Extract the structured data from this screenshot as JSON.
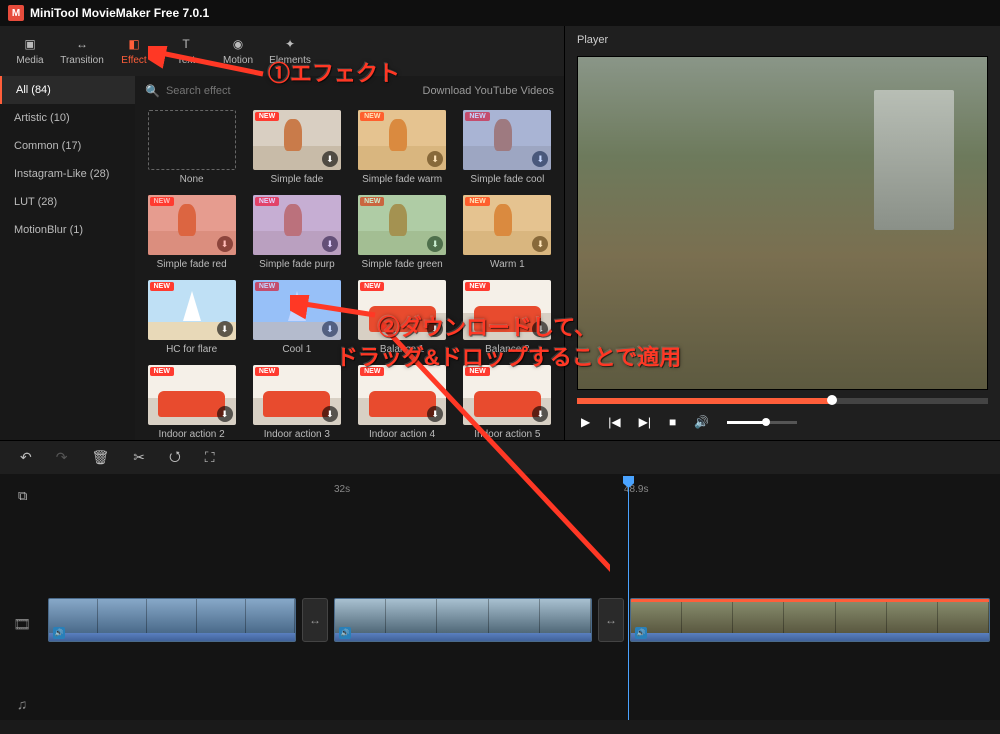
{
  "app": {
    "title": "MiniTool MovieMaker Free 7.0.1"
  },
  "tabs": [
    {
      "label": "Media"
    },
    {
      "label": "Transition"
    },
    {
      "label": "Effect"
    },
    {
      "label": "Text"
    },
    {
      "label": "Motion"
    },
    {
      "label": "Elements"
    }
  ],
  "categories": [
    {
      "label": "All (84)"
    },
    {
      "label": "Artistic (10)"
    },
    {
      "label": "Common (17)"
    },
    {
      "label": "Instagram-Like (28)"
    },
    {
      "label": "LUT (28)"
    },
    {
      "label": "MotionBlur (1)"
    }
  ],
  "search": {
    "placeholder": "Search effect"
  },
  "download_link": "Download YouTube Videos",
  "effects": [
    {
      "label": "None",
      "new": false,
      "dl": false,
      "cls": "none"
    },
    {
      "label": "Simple fade",
      "new": true,
      "dl": true,
      "cls": "t-vase"
    },
    {
      "label": "Simple fade warm",
      "new": true,
      "dl": true,
      "cls": "t-vase t-warm"
    },
    {
      "label": "Simple fade cool",
      "new": true,
      "dl": true,
      "cls": "t-vase t-cool"
    },
    {
      "label": "Simple fade red",
      "new": true,
      "dl": true,
      "cls": "t-vase t-red"
    },
    {
      "label": "Simple fade purp",
      "new": true,
      "dl": true,
      "cls": "t-vase t-purp"
    },
    {
      "label": "Simple fade green",
      "new": true,
      "dl": true,
      "cls": "t-vase t-green"
    },
    {
      "label": "Warm 1",
      "new": true,
      "dl": true,
      "cls": "t-vase t-warm"
    },
    {
      "label": "HC for flare",
      "new": true,
      "dl": true,
      "cls": "t-sky"
    },
    {
      "label": "Cool 1",
      "new": true,
      "dl": true,
      "cls": "t-sky t-cool"
    },
    {
      "label": "Balance 1",
      "new": true,
      "dl": true,
      "cls": "t-sofa"
    },
    {
      "label": "Balance 2",
      "new": true,
      "dl": true,
      "cls": "t-sofa"
    },
    {
      "label": "Indoor action 2",
      "new": true,
      "dl": true,
      "cls": "t-sofa"
    },
    {
      "label": "Indoor action 3",
      "new": true,
      "dl": true,
      "cls": "t-sofa"
    },
    {
      "label": "Indoor action 4",
      "new": true,
      "dl": true,
      "cls": "t-sofa"
    },
    {
      "label": "Indoor action 5",
      "new": true,
      "dl": true,
      "cls": "t-sofa"
    }
  ],
  "badges": {
    "new": "NEW"
  },
  "player": {
    "title": "Player"
  },
  "ruler": {
    "mark1": "32s",
    "mark2": "48.9s"
  },
  "annotations": {
    "a1": "①エフェクト",
    "a2": "②ダウンロードして、",
    "a3": "ドラッグ&ドロップすることで適用"
  }
}
